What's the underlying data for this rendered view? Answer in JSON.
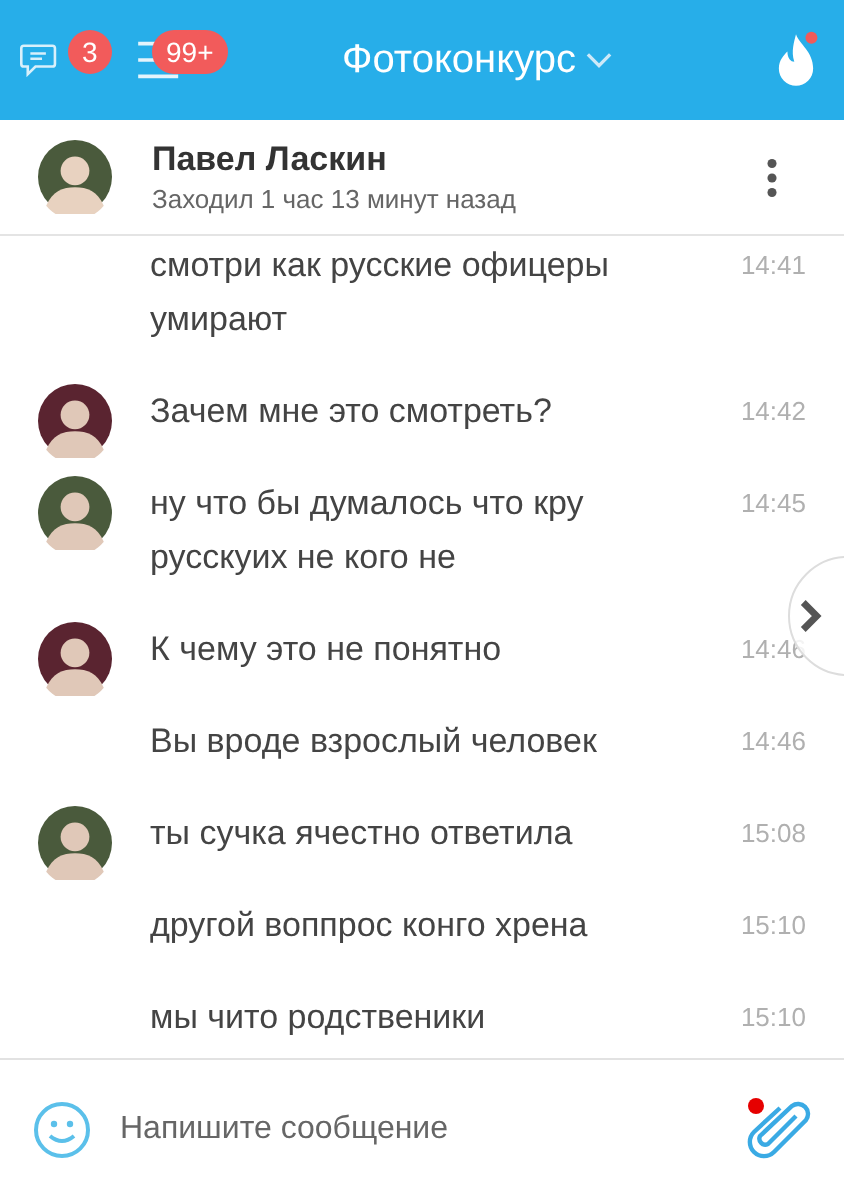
{
  "top_bar": {
    "chats_badge": "3",
    "menu_badge": "99+",
    "title": "Фотоконкурс",
    "flame_notification": true
  },
  "contact": {
    "name": "Павел Ласкин",
    "status": "Заходил 1 час 13 минут назад"
  },
  "messages": [
    {
      "text": "смотри как русские офицеры умирают",
      "time": "14:41"
    },
    {
      "avatar": true,
      "color": "#5a2430",
      "text": "Зачем мне это смотреть?",
      "time": "14:42"
    },
    {
      "avatar": true,
      "color": "#4a5a3c",
      "text": "ну что бы думалось что кру русскуих не кого не",
      "time": "14:45"
    },
    {
      "avatar": true,
      "color": "#5a2430",
      "text": "К чему это не понятно",
      "time": "14:46"
    },
    {
      "text": "Вы вроде взрослый человек",
      "time": "14:46"
    },
    {
      "avatar": true,
      "color": "#4a5a3c",
      "text": "ты сучка ячестно ответила",
      "time": "15:08"
    },
    {
      "text": "другой воппрос конго хрена",
      "time": "15:10"
    },
    {
      "text": "мы чито родственики",
      "time": "15:10"
    }
  ],
  "composer": {
    "placeholder": "Напишите сообщение",
    "attach_notification": true
  }
}
